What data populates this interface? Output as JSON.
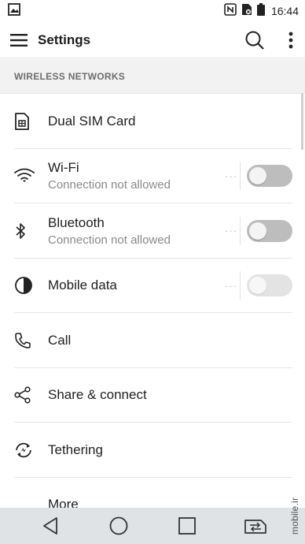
{
  "status_bar": {
    "time": "16:44"
  },
  "app_bar": {
    "title": "Settings"
  },
  "section": {
    "header": "WIRELESS NETWORKS"
  },
  "rows": [
    {
      "label": "Dual SIM Card",
      "icon": "sim-card-icon"
    },
    {
      "label": "Wi-Fi",
      "sub": "Connection not allowed",
      "icon": "wifi-icon",
      "toggle": "off"
    },
    {
      "label": "Bluetooth",
      "sub": "Connection not allowed",
      "icon": "bluetooth-icon",
      "toggle": "off"
    },
    {
      "label": "Mobile data",
      "icon": "mobile-data-icon",
      "toggle": "disabled"
    },
    {
      "label": "Call",
      "icon": "phone-icon"
    },
    {
      "label": "Share & connect",
      "icon": "share-icon"
    },
    {
      "label": "Tethering",
      "icon": "tethering-icon"
    },
    {
      "label": "More"
    }
  ],
  "dots": "···",
  "watermark": "mobile.ir",
  "colors": {
    "toggle_off": "#bdbdbd",
    "toggle_disabled": "#e3e3e3",
    "section_bg": "#f2f2f2",
    "navbar_bg": "#dfe3e6"
  }
}
